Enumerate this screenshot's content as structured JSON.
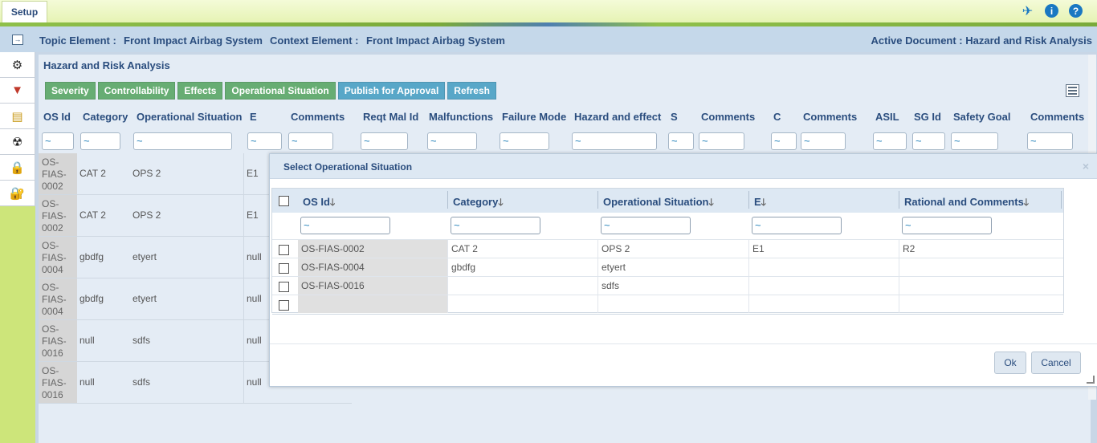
{
  "topbar": {
    "tab": "Setup",
    "icons": [
      "pin-icon",
      "info-icon",
      "help-icon"
    ]
  },
  "sidebar": {
    "items": [
      "exit-icon",
      "gear-icon",
      "layers-icon",
      "database-icon",
      "hazard-icon",
      "lock-icon",
      "locked-icon"
    ]
  },
  "context": {
    "topic_label": "Topic Element :",
    "topic_value": "Front Impact Airbag System",
    "context_label": "Context Element :",
    "context_value": "Front Impact Airbag System",
    "active_doc": "Active Document : Hazard and Risk Analysis"
  },
  "panel": {
    "title": "Hazard and Risk Analysis",
    "buttons": [
      "Severity",
      "Controllability",
      "Effects",
      "Operational Situation",
      "Publish for Approval",
      "Refresh"
    ],
    "columns": [
      "OS Id",
      "Category",
      "Operational Situation",
      "E",
      "Comments",
      "Reqt Mal Id",
      "Malfunctions",
      "Failure Mode",
      "Hazard and effect",
      "S",
      "Comments",
      "C",
      "Comments",
      "ASIL",
      "SG Id",
      "Safety Goal",
      "Comments"
    ],
    "filter_symbol": "~",
    "rows": [
      {
        "id": "OS-\nFIAS-\n0002",
        "category": "CAT 2",
        "situation": "OPS 2",
        "e": "E1"
      },
      {
        "id": "OS-\nFIAS-\n0002",
        "category": "CAT 2",
        "situation": "OPS 2",
        "e": "E1"
      },
      {
        "id": "OS-\nFIAS-\n0004",
        "category": "gbdfg",
        "situation": "etyert",
        "e": "null"
      },
      {
        "id": "OS-\nFIAS-\n0004",
        "category": "gbdfg",
        "situation": "etyert",
        "e": "null"
      },
      {
        "id": "OS-\nFIAS-\n0016",
        "category": "null",
        "situation": "sdfs",
        "e": "null"
      },
      {
        "id": "OS-\nFIAS-\n0016",
        "category": "null",
        "situation": "sdfs",
        "e": "null"
      }
    ]
  },
  "dialog": {
    "title": "Select Operational Situation",
    "close": "×",
    "columns": [
      "OS Id",
      "Category",
      "Operational Situation",
      "E",
      "Rational and Comments"
    ],
    "sort_arrow": "🡓",
    "filter_symbol": "~",
    "rows": [
      {
        "id": "OS-FIAS-0002",
        "category": "CAT 2",
        "situation": "OPS 2",
        "e": "E1",
        "comments": "R2"
      },
      {
        "id": "OS-FIAS-0004",
        "category": "gbdfg",
        "situation": "etyert",
        "e": "",
        "comments": ""
      },
      {
        "id": "OS-FIAS-0016",
        "category": "",
        "situation": "sdfs",
        "e": "",
        "comments": ""
      },
      {
        "id": "",
        "category": "",
        "situation": "",
        "e": "",
        "comments": ""
      }
    ],
    "ok": "Ok",
    "cancel": "Cancel"
  }
}
